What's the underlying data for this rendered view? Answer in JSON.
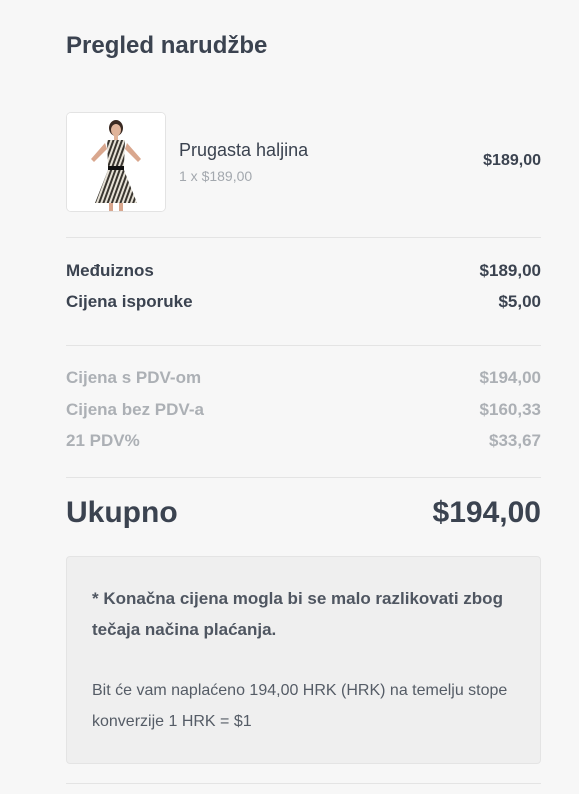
{
  "page": {
    "title": "Pregled narudžbe"
  },
  "item": {
    "name": "Prugasta haljina",
    "quantity_line": "1 x $189,00",
    "price": "$189,00",
    "image_icon": "striped-dress-product-image"
  },
  "subtotals": {
    "subtotal_label": "Međuiznos",
    "subtotal_value": "$189,00",
    "shipping_label": "Cijena isporuke",
    "shipping_value": "$5,00"
  },
  "tax": {
    "with_vat_label": "Cijena s PDV-om",
    "with_vat_value": "$194,00",
    "without_vat_label": "Cijena bez PDV-a",
    "without_vat_value": "$160,33",
    "vat_label": "21 PDV%",
    "vat_value": "$33,67"
  },
  "total": {
    "label": "Ukupno",
    "value": "$194,00"
  },
  "notice": {
    "bold_text": "* Konačna cijena mogla bi se malo razlikovati zbog tečaja načina plaćanja.",
    "text": "Bit će vam naplaćeno 194,00 HRK (HRK) na temelju stope konverzije 1 HRK = $1"
  },
  "colors": {
    "background": "#f7f7f7",
    "text_dark": "#3b4350",
    "text_muted": "#acb0b5",
    "notice_bg": "#efefef"
  }
}
